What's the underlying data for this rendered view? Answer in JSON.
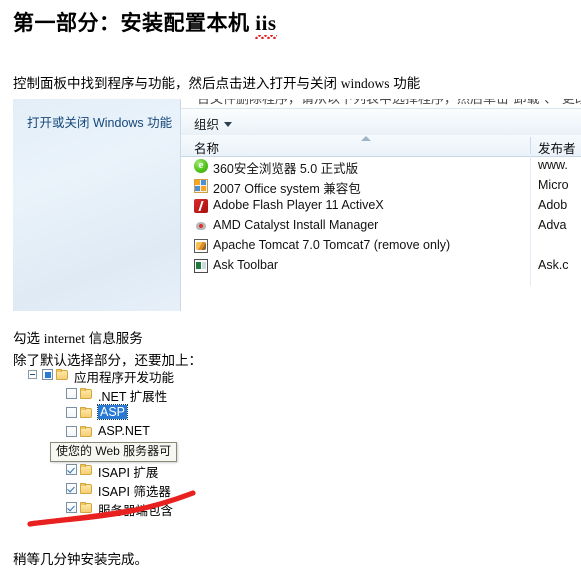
{
  "document": {
    "title_prefix": "第一部分：安装配置本机 ",
    "title_keyword": "iis",
    "para_control_panel_a": "控制面板中找到程序与功能，然后点击进入打开与关闭 ",
    "para_control_panel_b": "windows",
    "para_control_panel_c": " 功能",
    "para_check_iis_a": "勾选 ",
    "para_check_iis_b": "internet",
    "para_check_iis_c": " 信息服务",
    "para_besides": "除了默认选择部分，还要加上：",
    "para_finish": "稍等几分钟安装完成。"
  },
  "screenshot": {
    "nav_link": "打开或关闭 Windows 功能",
    "cut_text": "台文件删除程序，请从以下列表中选择程序，然后单击\"卸载\"、\"更改\"或",
    "toolbar": {
      "organize_label": "组织",
      "caret_icon": "chevron-down-icon"
    },
    "columns": {
      "name": "名称",
      "publisher": "发布者",
      "sort_icon": "sort-ascending-icon"
    },
    "programs": [
      {
        "icon": "browser-360-icon",
        "name": "360安全浏览器 5.0 正式版",
        "publisher": "www."
      },
      {
        "icon": "office-compat-pack-icon",
        "name": "2007 Office system 兼容包",
        "publisher": "Micro"
      },
      {
        "icon": "adobe-flash-icon",
        "name": "Adobe Flash Player 11 ActiveX",
        "publisher": "Adob"
      },
      {
        "icon": "amd-catalyst-icon",
        "name": "AMD Catalyst Install Manager",
        "publisher": "Adva"
      },
      {
        "icon": "apache-tomcat-icon",
        "name": "Apache Tomcat 7.0 Tomcat7 (remove only)",
        "publisher": ""
      },
      {
        "icon": "ask-toolbar-icon",
        "name": "Ask Toolbar",
        "publisher": "Ask.c"
      }
    ]
  },
  "features_tree": {
    "root": {
      "label": "应用程序开发功能",
      "checkbox_state": "filled",
      "expander": "collapse-icon"
    },
    "children": [
      {
        "label": ".NET 扩展性",
        "checkbox_state": "unchecked",
        "selected": false
      },
      {
        "label": "ASP",
        "checkbox_state": "unchecked",
        "selected": true
      },
      {
        "label": "ASP.NET",
        "checkbox_state": "unchecked",
        "selected": false
      },
      {
        "label": "",
        "checkbox_state": "unchecked",
        "selected": false
      },
      {
        "label": "ISAPI 扩展",
        "checkbox_state": "checked",
        "selected": false
      },
      {
        "label": "ISAPI 筛选器",
        "checkbox_state": "checked",
        "selected": false
      },
      {
        "label": "服务器端包含",
        "checkbox_state": "checked",
        "selected": false
      }
    ],
    "tooltip": "使您的 Web 服务器可"
  },
  "annotation": {
    "name": "red-ink-underline",
    "color": "#e8201f"
  },
  "colors": {
    "link_blue": "#16477a",
    "selection_blue": "#2a7ad4",
    "annotation_red": "#e8201f",
    "spellcheck_red": "#e02020"
  }
}
